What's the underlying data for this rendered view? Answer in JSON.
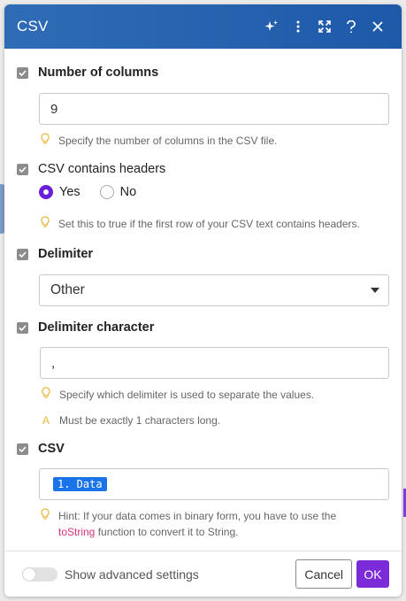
{
  "header": {
    "title": "CSV"
  },
  "icons": {
    "magic": "sparkles-icon",
    "more": "kebab-menu-icon",
    "expand": "expand-icon",
    "help": "help-icon",
    "close": "close-icon"
  },
  "sections": {
    "columns": {
      "label": "Number of columns",
      "value": "9",
      "hint": "Specify the number of columns in the CSV file."
    },
    "headers": {
      "label": "CSV contains headers",
      "yes": "Yes",
      "no": "No",
      "selected": "Yes",
      "hint": "Set this to true if the first row of your CSV text contains headers."
    },
    "delimiter": {
      "label": "Delimiter",
      "value": "Other"
    },
    "delimiter_char": {
      "label": "Delimiter character",
      "value": ",",
      "hint": "Specify which delimiter is used to separate the values.",
      "warning": "Must be exactly 1 characters long."
    },
    "csv": {
      "label": "CSV",
      "token": "1. Data",
      "hint_before": "Hint: If your data comes in binary form, you have to use the",
      "hint_func": "toString",
      "hint_after": "function to convert it to String."
    }
  },
  "footer": {
    "advanced": "Show advanced settings",
    "cancel": "Cancel",
    "ok": "OK"
  },
  "colors": {
    "header": "#2f6cb6",
    "accent": "#7b2bd8",
    "token": "#1a73e8",
    "function": "#d6317a"
  }
}
